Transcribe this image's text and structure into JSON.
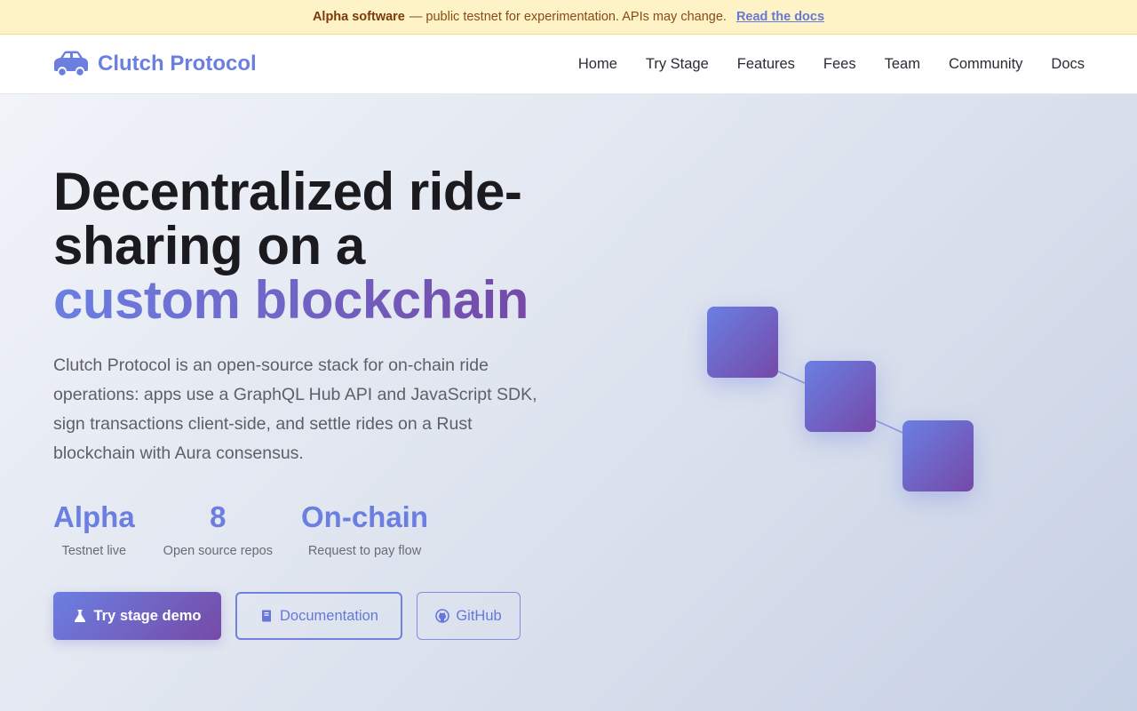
{
  "banner": {
    "strong": "Alpha software",
    "text": "— public testnet for experimentation. APIs may change.",
    "link": "Read the docs"
  },
  "nav": {
    "brand": "Clutch Protocol",
    "brand_icon": "car-icon",
    "items": [
      "Home",
      "Try Stage",
      "Features",
      "Fees",
      "Team",
      "Community",
      "Docs"
    ]
  },
  "hero": {
    "title_line1": "Decentralized ride-",
    "title_line2": "sharing on a",
    "title_highlight": "custom blockchain",
    "description": "Clutch Protocol is an open-source stack for on-chain ride operations: apps use a GraphQL Hub API and JavaScript SDK, sign transactions client-side, and settle rides on a Rust blockchain with Aura consensus.",
    "stats": [
      {
        "value": "Alpha",
        "label": "Testnet live"
      },
      {
        "value": "8",
        "label": "Open source repos"
      },
      {
        "value": "On-chain",
        "label": "Request to pay flow"
      }
    ],
    "buttons": {
      "primary": "Try stage demo",
      "primary_icon": "flask-icon",
      "docs": "Documentation",
      "docs_icon": "book-icon",
      "github": "GitHub",
      "github_icon": "github-icon"
    }
  },
  "colors": {
    "accent": "#6b7fe0",
    "accent_end": "#764aa6",
    "banner_bg": "#fdf3c6",
    "banner_text": "#8a4a16"
  }
}
